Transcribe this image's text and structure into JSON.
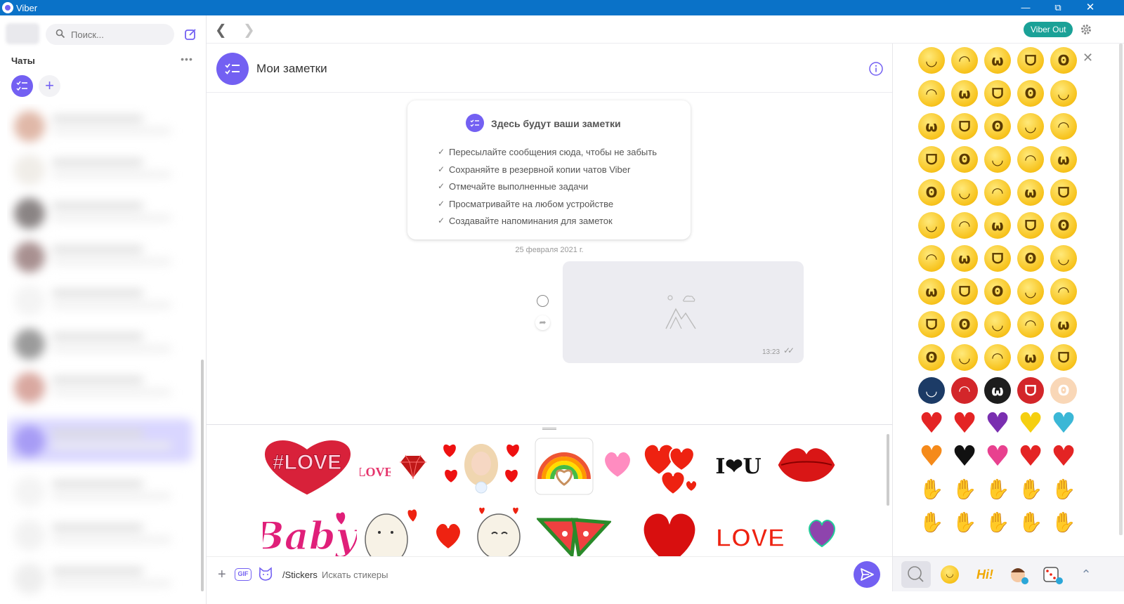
{
  "window": {
    "title": "Viber"
  },
  "sidebar": {
    "search_placeholder": "Поиск...",
    "chats_label": "Чаты",
    "more_label": "•••"
  },
  "topbar": {
    "viber_out_label": "Viber Out"
  },
  "chat": {
    "name": "Мои заметки"
  },
  "notes_card": {
    "heading": "Здесь будут ваши заметки",
    "items": [
      "Пересылайте сообщения сюда, чтобы не забыть",
      "Сохраняйте в резервной копии чатов Viber",
      "Отмечайте выполненные задачи",
      "Просматривайте на любом устройстве",
      "Создавайте напоминания для заметок"
    ]
  },
  "messages": {
    "date_label": "25 февраля 2021 г.",
    "image_time": "13:23"
  },
  "input": {
    "gif_label": "GIF",
    "command": "/Stickers",
    "placeholder": "Искать стикеры"
  },
  "stickers": {
    "row1": [
      "#LOVE",
      "LOVE",
      "💎",
      "❤️",
      "🌈",
      "💗",
      "❤️",
      "I❤U",
      "💋"
    ],
    "row2": [
      "Baby",
      "🐱",
      "❤️",
      "😊",
      "🍉",
      "❤️",
      "LOVE",
      "💜"
    ]
  },
  "emoji_panel": {
    "colors": {
      "face": "#f7c21b",
      "accent": "#7360f2"
    },
    "faces_rows": [
      [
        "😊",
        "🙄",
        "😜",
        "😡",
        "😍"
      ],
      [
        "😃",
        "😄",
        "😮",
        "😘",
        "😊"
      ],
      [
        "😫",
        "🤢",
        "🥺",
        "😁",
        "😛"
      ],
      [
        "🤑",
        "😏",
        "😉",
        "😆",
        "😒"
      ],
      [
        "😔",
        "😤",
        "🤓",
        "😌",
        "😎"
      ],
      [
        "😲",
        "😂",
        "😚",
        "😖",
        "😁"
      ],
      [
        "😵",
        "😵",
        "🙂",
        "😏",
        "😠"
      ],
      [
        "😬",
        "😯",
        "😏",
        "😕",
        "😟"
      ],
      [
        "😠",
        "😣",
        "😢",
        "🙃",
        "😀"
      ],
      [
        "😋",
        "😏",
        "🤔",
        "😭",
        "🙄"
      ]
    ],
    "special_row": [
      "🦹",
      "🕷",
      "🦇",
      "😈",
      "😇"
    ],
    "hearts_row": [
      "❤",
      "💔",
      "💜",
      "💛",
      "💙"
    ],
    "hearts_row2": [
      "🧡",
      "🖤",
      "💕",
      "💘",
      "💝"
    ],
    "hands_row": [
      "👎",
      "👍",
      "✌",
      "👆",
      "👋"
    ],
    "hands_row2": [
      "🤘",
      "☝",
      "👏",
      "👊",
      "🙏"
    ],
    "tabs": [
      "search-icon",
      "smiley-icon",
      "hi-icon",
      "avatar-sticker-icon",
      "dice-sticker-icon",
      "chevron-up-icon"
    ],
    "hi_label": "Hi!"
  }
}
